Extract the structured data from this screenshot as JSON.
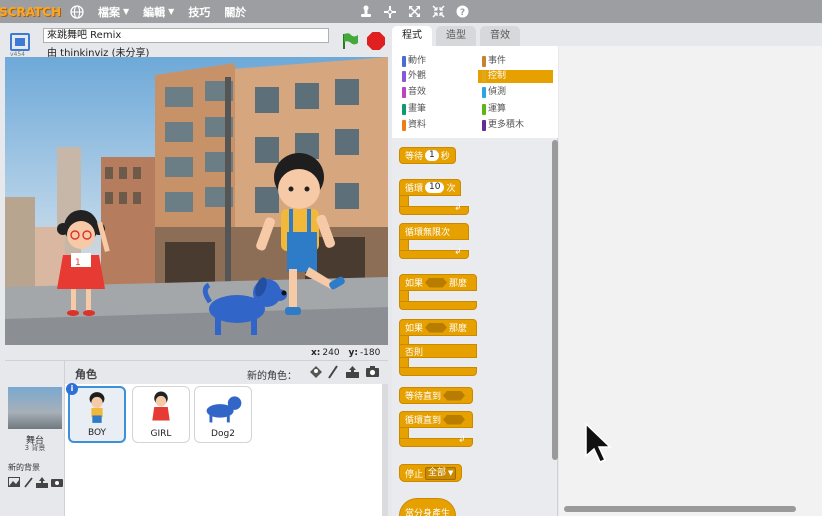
{
  "menubar": {
    "logo": "SCRATCH",
    "items": [
      {
        "label": "檔案",
        "has_caret": true
      },
      {
        "label": "編輯",
        "has_caret": true
      },
      {
        "label": "技巧",
        "has_caret": false
      },
      {
        "label": "關於",
        "has_caret": false
      }
    ],
    "icons": [
      "globe-icon",
      "duplicate-stamp-icon",
      "cut-icon",
      "grow-icon",
      "shrink-icon",
      "help-icon"
    ]
  },
  "project": {
    "title": "來跳舞吧 Remix",
    "author": "由 thinkinviz (未分享)",
    "version": "v454"
  },
  "stage": {
    "x_label": "x:",
    "x_value": "240",
    "y_label": "y:",
    "y_value": "-180"
  },
  "sprites_pane": {
    "header": "角色",
    "new_sprite": "新的角色：",
    "stage_name": "舞台",
    "stage_backdrops": "3 背景",
    "new_backdrop": "新的背景",
    "sprites": [
      {
        "name": "BOY",
        "selected": true
      },
      {
        "name": "GIRL",
        "selected": false
      },
      {
        "name": "Dog2",
        "selected": false
      }
    ],
    "info_badge": "i"
  },
  "tabs": [
    {
      "label": "程式",
      "active": true
    },
    {
      "label": "造型",
      "active": false
    },
    {
      "label": "音效",
      "active": false
    }
  ],
  "categories": [
    {
      "label": "動作",
      "color": "#4a6cd4",
      "active": false
    },
    {
      "label": "事件",
      "color": "#c88330",
      "active": false
    },
    {
      "label": "外觀",
      "color": "#8a55d7",
      "active": false
    },
    {
      "label": "控制",
      "color": "#e1a91a",
      "active": true
    },
    {
      "label": "音效",
      "color": "#bb42c3",
      "active": false
    },
    {
      "label": "偵測",
      "color": "#2ca5e2",
      "active": false
    },
    {
      "label": "畫筆",
      "color": "#0e9a6c",
      "active": false
    },
    {
      "label": "運算",
      "color": "#5cb712",
      "active": false
    },
    {
      "label": "資料",
      "color": "#ee7d16",
      "active": false
    },
    {
      "label": "更多積木",
      "color": "#632d99",
      "active": false
    }
  ],
  "blocks": {
    "wait": {
      "pre": "等待",
      "value": "1",
      "post": "秒"
    },
    "repeat": {
      "pre": "循環",
      "value": "10",
      "post": "次"
    },
    "forever": {
      "label": "循環無限次"
    },
    "if_then": {
      "pre": "如果",
      "post": "那麼"
    },
    "if_else": {
      "pre": "如果",
      "post": "那麼",
      "else": "否則"
    },
    "wait_until": {
      "label": "等待直到"
    },
    "repeat_until": {
      "label": "循環直到"
    },
    "stop": {
      "label": "停止",
      "option": "全部"
    },
    "when_clone": {
      "label": "當分身產生"
    }
  }
}
